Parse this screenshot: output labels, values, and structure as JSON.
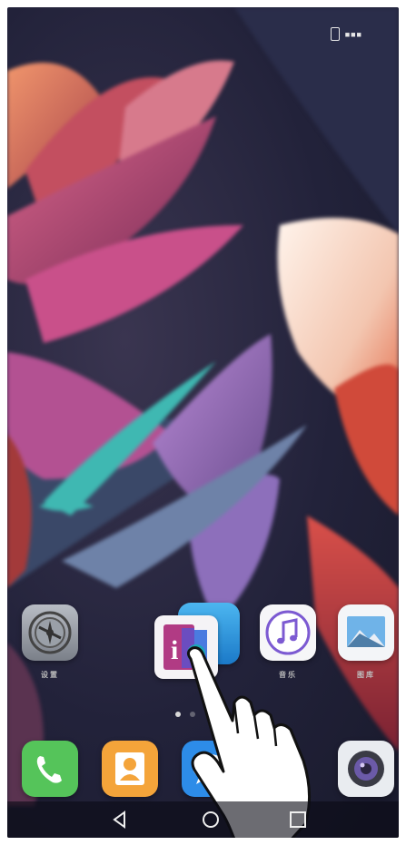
{
  "status_bar": {
    "battery_text": "■■■"
  },
  "home_apps": [
    {
      "name": "settings-app",
      "icon": "gear-icon",
      "label": "设置"
    },
    {
      "name": "ibooks-app",
      "icon": "reader-icon",
      "label": ""
    },
    {
      "name": "music-app",
      "icon": "music-note-icon",
      "label": "音乐"
    },
    {
      "name": "gallery-app",
      "icon": "photo-icon",
      "label": "图库"
    }
  ],
  "page_indicator": {
    "pages": 2,
    "active": 1
  },
  "dock_apps": [
    {
      "name": "phone-app",
      "icon": "phone-icon"
    },
    {
      "name": "contacts-app",
      "icon": "contact-icon"
    },
    {
      "name": "messages-app",
      "icon": "chat-bubble-icon"
    },
    {
      "name": "camera-app",
      "icon": "camera-icon"
    }
  ],
  "nav_bar": [
    "back",
    "home",
    "recents"
  ],
  "colors": {
    "phone_green": "#55c45a",
    "contacts_orange": "#f4a43a",
    "messages_blue": "#2d8ce8",
    "touch_ring": "#1aa8b8"
  }
}
